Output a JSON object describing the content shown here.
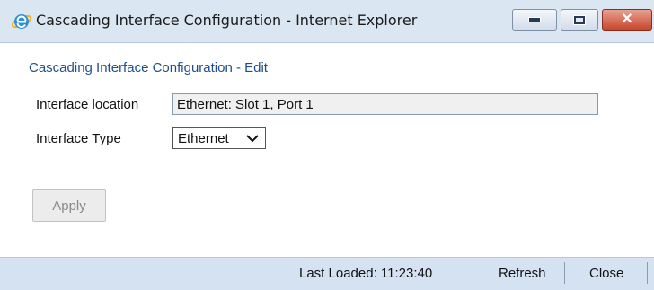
{
  "window": {
    "title": "Cascading Interface Configuration - Internet Explorer",
    "icon": "internet-explorer-icon",
    "close_button_color": "#c7472e"
  },
  "form": {
    "heading": "Cascading Interface Configuration - Edit",
    "location_label": "Interface location",
    "location_value": "Ethernet: Slot 1, Port 1",
    "type_label": "Interface Type",
    "type_value": "Ethernet",
    "apply_label": "Apply"
  },
  "footer": {
    "last_loaded": "Last Loaded: 11:23:40",
    "refresh_label": "Refresh",
    "close_label": "Close"
  },
  "colors": {
    "heading": "#1f4e8c",
    "titlebar": "#dbe6f3",
    "footer": "#d5e2f1"
  }
}
